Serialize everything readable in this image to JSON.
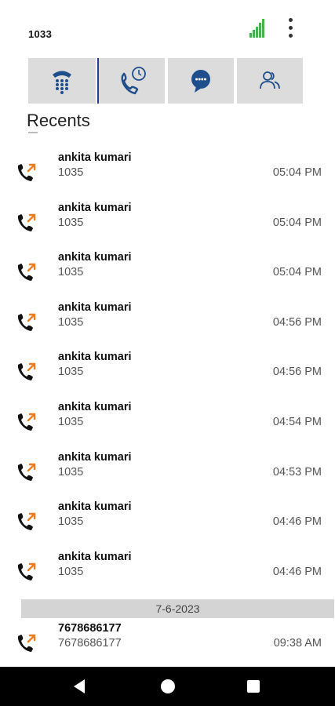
{
  "status": {
    "extension": "1033"
  },
  "header": {
    "title": "Recents"
  },
  "tabs": [
    {
      "icon": "keypad-phone-icon"
    },
    {
      "icon": "call-history-icon"
    },
    {
      "icon": "chat-bubble-icon"
    },
    {
      "icon": "contacts-icon"
    }
  ],
  "calls": [
    {
      "name": "ankita kumari",
      "number": "1035",
      "time": "05:04 PM",
      "icon": "outgoing-call-icon"
    },
    {
      "name": "ankita kumari",
      "number": "1035",
      "time": "05:04 PM",
      "icon": "outgoing-call-icon"
    },
    {
      "name": "ankita kumari",
      "number": "1035",
      "time": "05:04 PM",
      "icon": "outgoing-call-icon"
    },
    {
      "name": "ankita kumari",
      "number": "1035",
      "time": "04:56 PM",
      "icon": "outgoing-call-icon"
    },
    {
      "name": "ankita kumari",
      "number": "1035",
      "time": "04:56 PM",
      "icon": "outgoing-call-icon"
    },
    {
      "name": "ankita kumari",
      "number": "1035",
      "time": "04:54 PM",
      "icon": "outgoing-call-icon"
    },
    {
      "name": "ankita kumari",
      "number": "1035",
      "time": "04:53 PM",
      "icon": "outgoing-call-icon"
    },
    {
      "name": "ankita kumari",
      "number": "1035",
      "time": "04:46 PM",
      "icon": "outgoing-call-icon"
    },
    {
      "name": "ankita kumari",
      "number": "1035",
      "time": "04:46 PM",
      "icon": "outgoing-call-icon"
    }
  ],
  "date_separator": "7-6-2023",
  "older_calls": [
    {
      "name": "7678686177",
      "number": "7678686177",
      "time": "09:38 AM",
      "icon": "outgoing-call-icon"
    }
  ],
  "colors": {
    "accent": "#1f4e8c",
    "outgoing": "#f07c1f",
    "signal": "#4caf50",
    "tab_bg": "#dcdcdc"
  }
}
